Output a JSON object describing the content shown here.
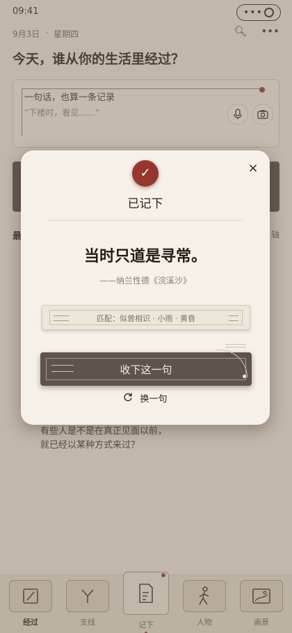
{
  "status_bar": {
    "time": "09:41",
    "capsule_menu": "•••"
  },
  "header": {
    "date": "9月3日",
    "separator": "·",
    "weekday": "星期四"
  },
  "page_title": "今天，谁从你的生活里经过？",
  "input_card": {
    "prompt": "一句话，也算一条记录",
    "placeholder": "“下楼时，看见……”"
  },
  "background": {
    "section_label": "最",
    "right_label": "轴",
    "body_lines": [
      "有些人是不是在真正见面以前，",
      "就已经以某种方式来过？"
    ]
  },
  "modal": {
    "check_glyph": "✓",
    "title": "已记下",
    "quote": "当时只道是寻常。",
    "source": "——纳兰性德《浣溪沙》",
    "match_text": "匹配：似曾相识 · 小雨 · 黄昏",
    "primary_label": "收下这一句",
    "secondary_label": "换一句",
    "close_glyph": "×"
  },
  "tabs": [
    {
      "label": "经过",
      "icon": "scroll-icon"
    },
    {
      "label": "支线",
      "icon": "branch-icon"
    },
    {
      "label": "记下",
      "icon": "note-icon"
    },
    {
      "label": "人物",
      "icon": "person-icon"
    },
    {
      "label": "画景",
      "icon": "picture-icon"
    }
  ],
  "colors": {
    "accent": "#96362e",
    "dark_button": "#5e544d",
    "paper": "#f5f1e8"
  }
}
